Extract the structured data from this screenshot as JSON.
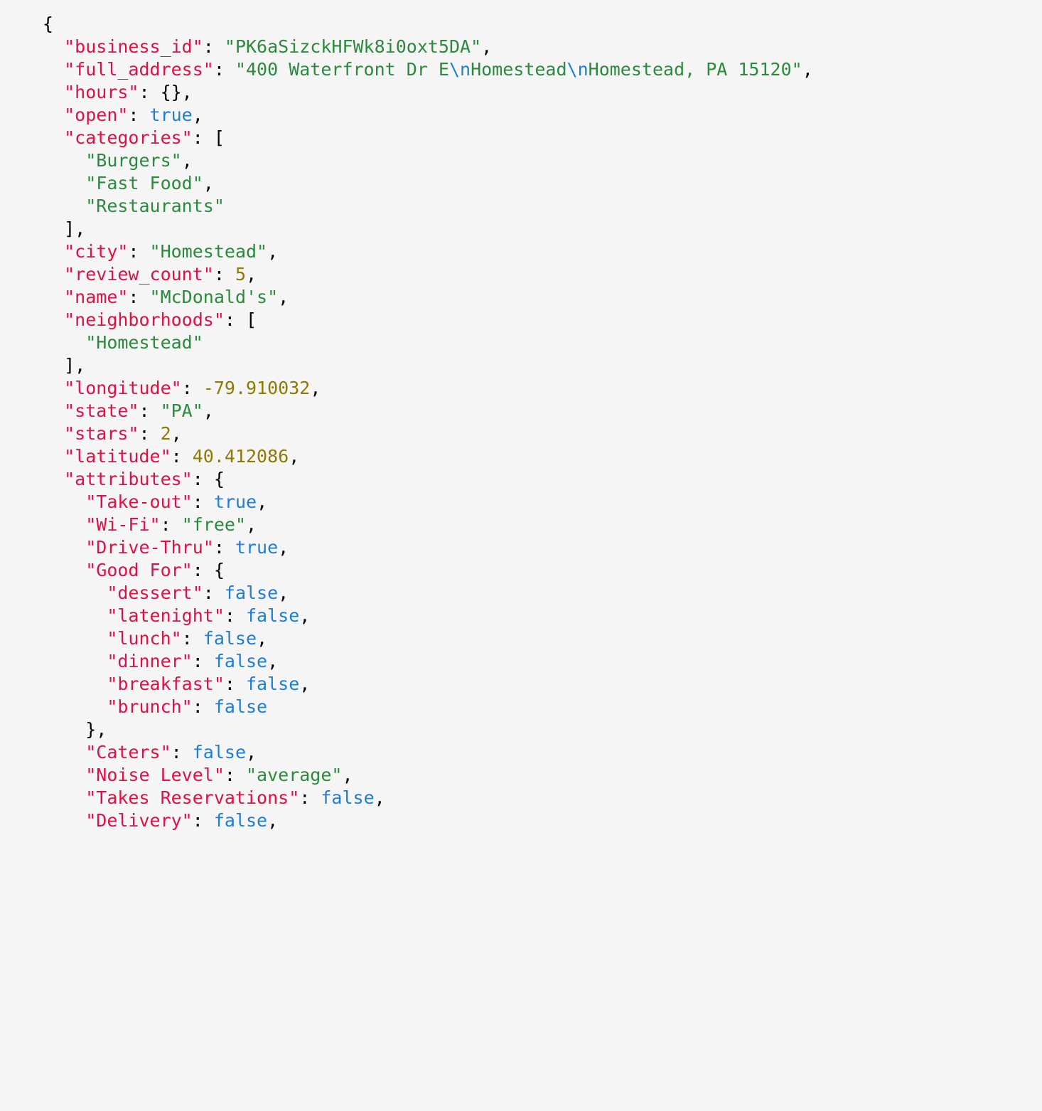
{
  "code": {
    "business_id_key": "\"business_id\"",
    "business_id_val": "\"PK6aSizckHFWk8i0oxt5DA\"",
    "full_address_key": "\"full_address\"",
    "full_address_val_p1": "\"400 Waterfront Dr E",
    "full_address_val_e1": "\\n",
    "full_address_val_p2": "Homestead",
    "full_address_val_e2": "\\n",
    "full_address_val_p3": "Homestead, PA 15120\"",
    "hours_key": "\"hours\"",
    "open_key": "\"open\"",
    "open_val": "true",
    "categories_key": "\"categories\"",
    "categories_v0": "\"Burgers\"",
    "categories_v1": "\"Fast Food\"",
    "categories_v2": "\"Restaurants\"",
    "city_key": "\"city\"",
    "city_val": "\"Homestead\"",
    "review_count_key": "\"review_count\"",
    "review_count_val": "5",
    "name_key": "\"name\"",
    "name_val": "\"McDonald's\"",
    "neighborhoods_key": "\"neighborhoods\"",
    "neighborhoods_v0": "\"Homestead\"",
    "longitude_key": "\"longitude\"",
    "longitude_val": "-79.910032",
    "state_key": "\"state\"",
    "state_val": "\"PA\"",
    "stars_key": "\"stars\"",
    "stars_val": "2",
    "latitude_key": "\"latitude\"",
    "latitude_val": "40.412086",
    "attributes_key": "\"attributes\"",
    "attr_takeout_key": "\"Take-out\"",
    "attr_takeout_val": "true",
    "attr_wifi_key": "\"Wi-Fi\"",
    "attr_wifi_val": "\"free\"",
    "attr_drivethru_key": "\"Drive-Thru\"",
    "attr_drivethru_val": "true",
    "attr_goodfor_key": "\"Good For\"",
    "gf_dessert_key": "\"dessert\"",
    "gf_dessert_val": "false",
    "gf_latenight_key": "\"latenight\"",
    "gf_latenight_val": "false",
    "gf_lunch_key": "\"lunch\"",
    "gf_lunch_val": "false",
    "gf_dinner_key": "\"dinner\"",
    "gf_dinner_val": "false",
    "gf_breakfast_key": "\"breakfast\"",
    "gf_breakfast_val": "false",
    "gf_brunch_key": "\"brunch\"",
    "gf_brunch_val": "false",
    "attr_caters_key": "\"Caters\"",
    "attr_caters_val": "false",
    "attr_noise_key": "\"Noise Level\"",
    "attr_noise_val": "\"average\"",
    "attr_reserv_key": "\"Takes Reservations\"",
    "attr_reserv_val": "false",
    "attr_delivery_key": "\"Delivery\"",
    "attr_delivery_val": "false"
  }
}
